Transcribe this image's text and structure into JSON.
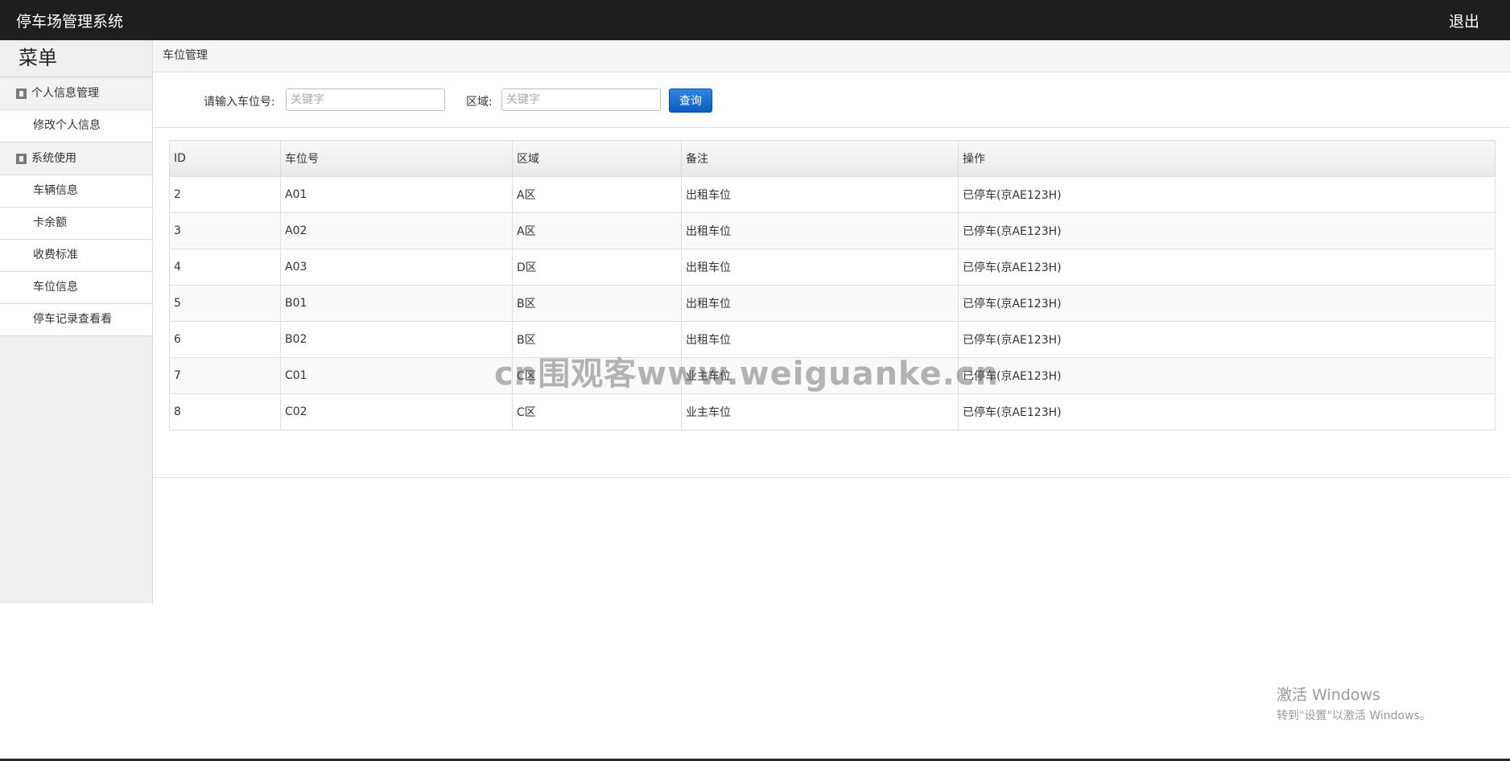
{
  "header": {
    "title": "停车场管理系统",
    "logout_label": "退出"
  },
  "sidebar": {
    "menu_title": "菜单",
    "groups": [
      {
        "label": "个人信息管理",
        "icon": "book-icon",
        "items": [
          "修改个人信息"
        ]
      },
      {
        "label": "系统使用",
        "icon": "book-icon",
        "items": [
          "车辆信息",
          "卡余额",
          "收费标准",
          "车位信息",
          "停车记录查看看"
        ]
      }
    ]
  },
  "breadcrumb": "车位管理",
  "search": {
    "space_label": "请输入车位号:",
    "space_placeholder": "关键字",
    "area_label": "区域:",
    "area_placeholder": "关键字",
    "button_label": "查询",
    "button_color": "#0b5bc4"
  },
  "table": {
    "columns": [
      "ID",
      "车位号",
      "区域",
      "备注",
      "操作"
    ],
    "rows": [
      [
        "2",
        "A01",
        "A区",
        "出租车位",
        "已停车(京AE123H)"
      ],
      [
        "3",
        "A02",
        "A区",
        "出租车位",
        "已停车(京AE123H)"
      ],
      [
        "4",
        "A03",
        "D区",
        "出租车位",
        "已停车(京AE123H)"
      ],
      [
        "5",
        "B01",
        "B区",
        "出租车位",
        "已停车(京AE123H)"
      ],
      [
        "6",
        "B02",
        "B区",
        "出租车位",
        "已停车(京AE123H)"
      ],
      [
        "7",
        "C01",
        "C区",
        "业主车位",
        "已停车(京AE123H)"
      ],
      [
        "8",
        "C02",
        "C区",
        "业主车位",
        "已停车(京AE123H)"
      ]
    ]
  },
  "watermark": "cn围观客www.weiguanke.cn",
  "os_notice": {
    "line1": "激活 Windows",
    "line2": "转到\"设置\"以激活 Windows。"
  }
}
